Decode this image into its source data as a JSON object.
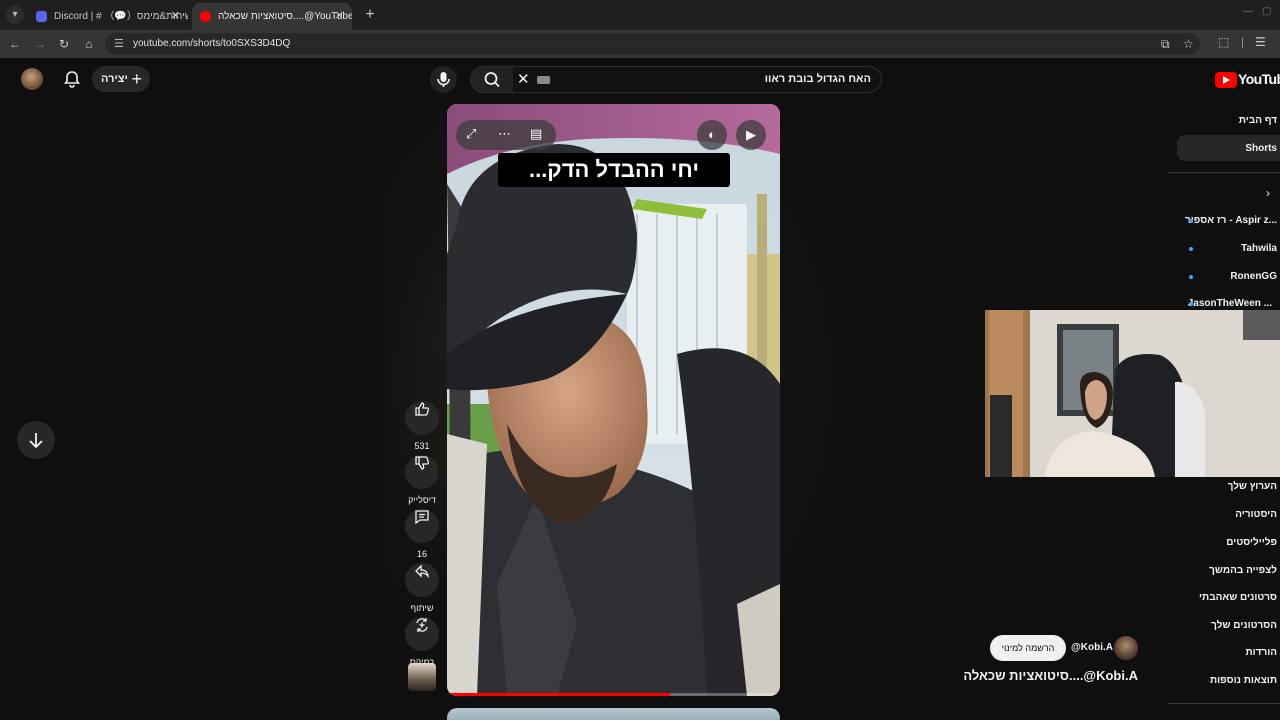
{
  "browser": {
    "tabs": [
      {
        "title": "Discord | # （💬）שיחות&מימס",
        "active": false,
        "icon": "discord-icon",
        "color": "#5865f2"
      },
      {
        "title": "סיטואציות שכאלה....@YouTube",
        "active": true,
        "icon": "youtube-icon",
        "color": "#ff0000"
      }
    ],
    "url": "youtube.com/shorts/to0SXS3D4DQ"
  },
  "header": {
    "create_label": "יצירה",
    "search_query": "האח הגדול בובת ראוו",
    "logo_text": "YouTube"
  },
  "video": {
    "caption": "יחי ההבדל הדק...",
    "progress": 0.67
  },
  "actions": {
    "like_count": "531",
    "dislike_label": "דיסלייק",
    "comment_count": "16",
    "share_label": "שיתוף",
    "remix_label": "רמיקס"
  },
  "sidebar": {
    "home": "דף הבית",
    "shorts": "Shorts",
    "subscriptions": [
      "רז אספיר - Aspir z...",
      "Tahwila",
      "RonenGG",
      "JasonTheWeen ..."
    ],
    "you_items": [
      "הערוץ שלך",
      "היסטוריה",
      "פלייליסטים",
      "לצפייה בהמשך",
      "סרטונים שאהבתי",
      "הסרטונים שלך",
      "הורדות",
      "תוצאות נוספות"
    ]
  },
  "channel": {
    "handle": "@Kobi.A",
    "subscribe_label": "הרשמה למינוי",
    "video_title": "סיטואציות שכאלה....@Kobi.A"
  },
  "colors": {
    "background": "#0f0f0f",
    "accent": "#ff0000",
    "surface": "#272727",
    "subscription_dot": "#3ea6ff"
  }
}
